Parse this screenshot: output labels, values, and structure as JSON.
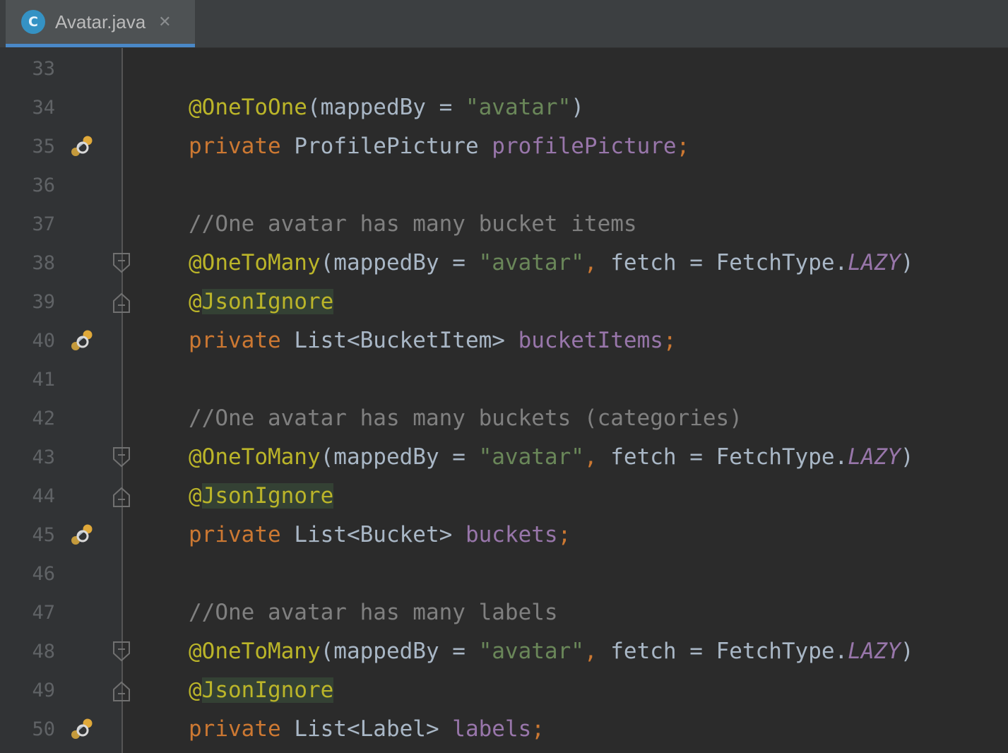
{
  "tab": {
    "icon_letter": "C",
    "file_name": "Avatar.java",
    "close_glyph": "✕"
  },
  "colors": {
    "annotation": "#bbb529",
    "keyword": "#cc7832",
    "string": "#6a8759",
    "field": "#9876aa",
    "comment": "#808080",
    "plain": "#a9b7c6"
  },
  "lines": [
    {
      "num": "33",
      "marker": "",
      "fold": ""
    },
    {
      "num": "34",
      "marker": "",
      "fold": "",
      "a": "@OneToOne",
      "b": "(mappedBy = ",
      "c": "\"avatar\"",
      "d": ")"
    },
    {
      "num": "35",
      "marker": "relation-icon",
      "fold": "",
      "a": "private",
      "b": " ProfilePicture ",
      "c": "profilePicture",
      "d": ";"
    },
    {
      "num": "36",
      "marker": "",
      "fold": ""
    },
    {
      "num": "37",
      "marker": "",
      "fold": "",
      "cmt": "//One avatar has many bucket items"
    },
    {
      "num": "38",
      "marker": "",
      "fold": "fold-start-icon",
      "a": "@OneToMany",
      "b": "(mappedBy = ",
      "c": "\"avatar\"",
      "d": ",",
      "e": " fetch = FetchType.",
      "f": "LAZY",
      "g": ")"
    },
    {
      "num": "39",
      "marker": "",
      "fold": "fold-end-icon",
      "a": "@",
      "b": "JsonIgnore"
    },
    {
      "num": "40",
      "marker": "relation-icon",
      "fold": "",
      "a": "private",
      "b": " List<BucketItem> ",
      "c": "bucketItems",
      "d": ";"
    },
    {
      "num": "41",
      "marker": "",
      "fold": ""
    },
    {
      "num": "42",
      "marker": "",
      "fold": "",
      "cmt": "//One avatar has many buckets (categories)"
    },
    {
      "num": "43",
      "marker": "",
      "fold": "fold-start-icon",
      "a": "@OneToMany",
      "b": "(mappedBy = ",
      "c": "\"avatar\"",
      "d": ",",
      "e": " fetch = FetchType.",
      "f": "LAZY",
      "g": ")"
    },
    {
      "num": "44",
      "marker": "",
      "fold": "fold-end-icon",
      "a": "@",
      "b": "JsonIgnore"
    },
    {
      "num": "45",
      "marker": "relation-icon",
      "fold": "",
      "a": "private",
      "b": " List<Bucket> ",
      "c": "buckets",
      "d": ";"
    },
    {
      "num": "46",
      "marker": "",
      "fold": ""
    },
    {
      "num": "47",
      "marker": "",
      "fold": "",
      "cmt": "//One avatar has many labels"
    },
    {
      "num": "48",
      "marker": "",
      "fold": "fold-start-icon",
      "a": "@OneToMany",
      "b": "(mappedBy = ",
      "c": "\"avatar\"",
      "d": ",",
      "e": " fetch = FetchType.",
      "f": "LAZY",
      "g": ")"
    },
    {
      "num": "49",
      "marker": "",
      "fold": "fold-end-icon",
      "a": "@",
      "b": "JsonIgnore"
    },
    {
      "num": "50",
      "marker": "relation-icon",
      "fold": "",
      "a": "private",
      "b": " List<Label> ",
      "c": "labels",
      "d": ";"
    }
  ]
}
